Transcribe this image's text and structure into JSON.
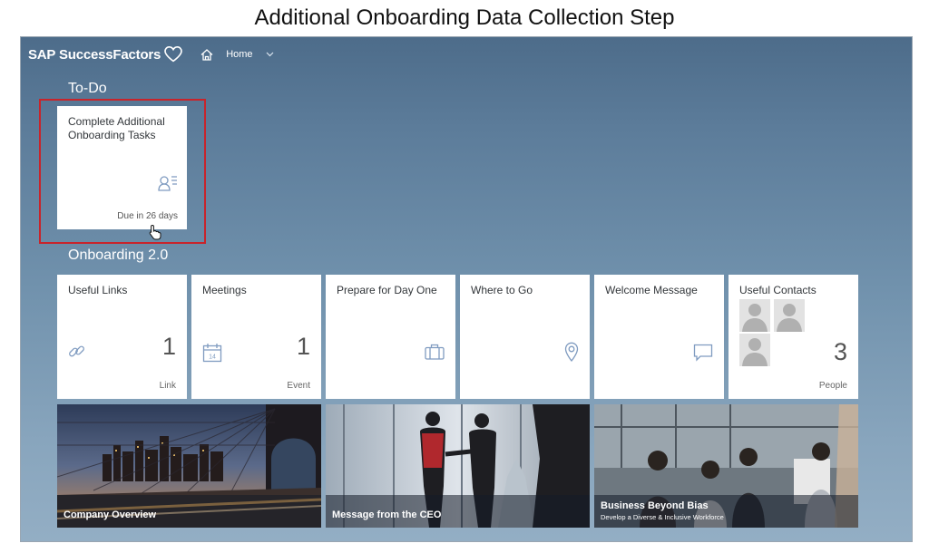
{
  "slide": {
    "title": "Additional Onboarding Data Collection Step"
  },
  "shell": {
    "product": "SAP SuccessFactors",
    "nav": "Home",
    "nav_icon": "chevron-down-icon",
    "home_icon": "home-icon"
  },
  "todo": {
    "section_title": "To-Do",
    "tile": {
      "title": "Complete Additional Onboarding Tasks",
      "due": "Due in 26 days",
      "icon": "person-list-icon"
    }
  },
  "onboarding": {
    "section_title": "Onboarding 2.0",
    "tiles": [
      {
        "title": "Useful Links",
        "count": "1",
        "unit": "Link",
        "icon": "link-icon"
      },
      {
        "title": "Meetings",
        "count": "1",
        "unit": "Event",
        "icon": "calendar-icon",
        "icon_text": "14"
      },
      {
        "title": "Prepare for Day One",
        "icon": "briefcase-icon"
      },
      {
        "title": "Where to Go",
        "icon": "location-pin-icon"
      },
      {
        "title": "Welcome Message",
        "icon": "message-icon"
      },
      {
        "title": "Useful Contacts",
        "count": "3",
        "unit": "People",
        "icon": "avatar-icon"
      }
    ],
    "media": [
      {
        "caption": "Company Overview"
      },
      {
        "caption": "Message from the CEO"
      },
      {
        "caption": "Business Beyond Bias",
        "subcaption": "Develop a Diverse & Inclusive Workforce"
      }
    ]
  },
  "colors": {
    "shell_bg": "#4d6c8a",
    "highlight": "#c8242b",
    "tile_bg": "#ffffff"
  }
}
